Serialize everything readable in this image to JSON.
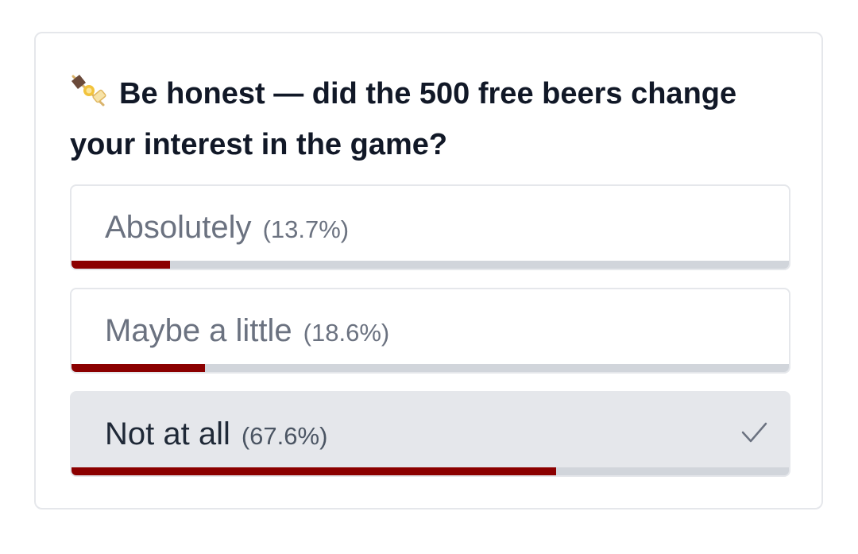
{
  "poll": {
    "question": "Be honest — did the 500 free beers change your interest in the game?",
    "question_icon": "oden-skewer-icon",
    "accent_color": "#8b0000",
    "track_color": "#d1d5db",
    "options": [
      {
        "label": "Absolutely",
        "percent_text": "(13.7%)",
        "percent": 13.7,
        "selected": false
      },
      {
        "label": "Maybe a little",
        "percent_text": "(18.6%)",
        "percent": 18.6,
        "selected": false
      },
      {
        "label": "Not at all",
        "percent_text": "(67.6%)",
        "percent": 67.6,
        "selected": true,
        "selected_icon": "checkmark-icon"
      }
    ]
  }
}
